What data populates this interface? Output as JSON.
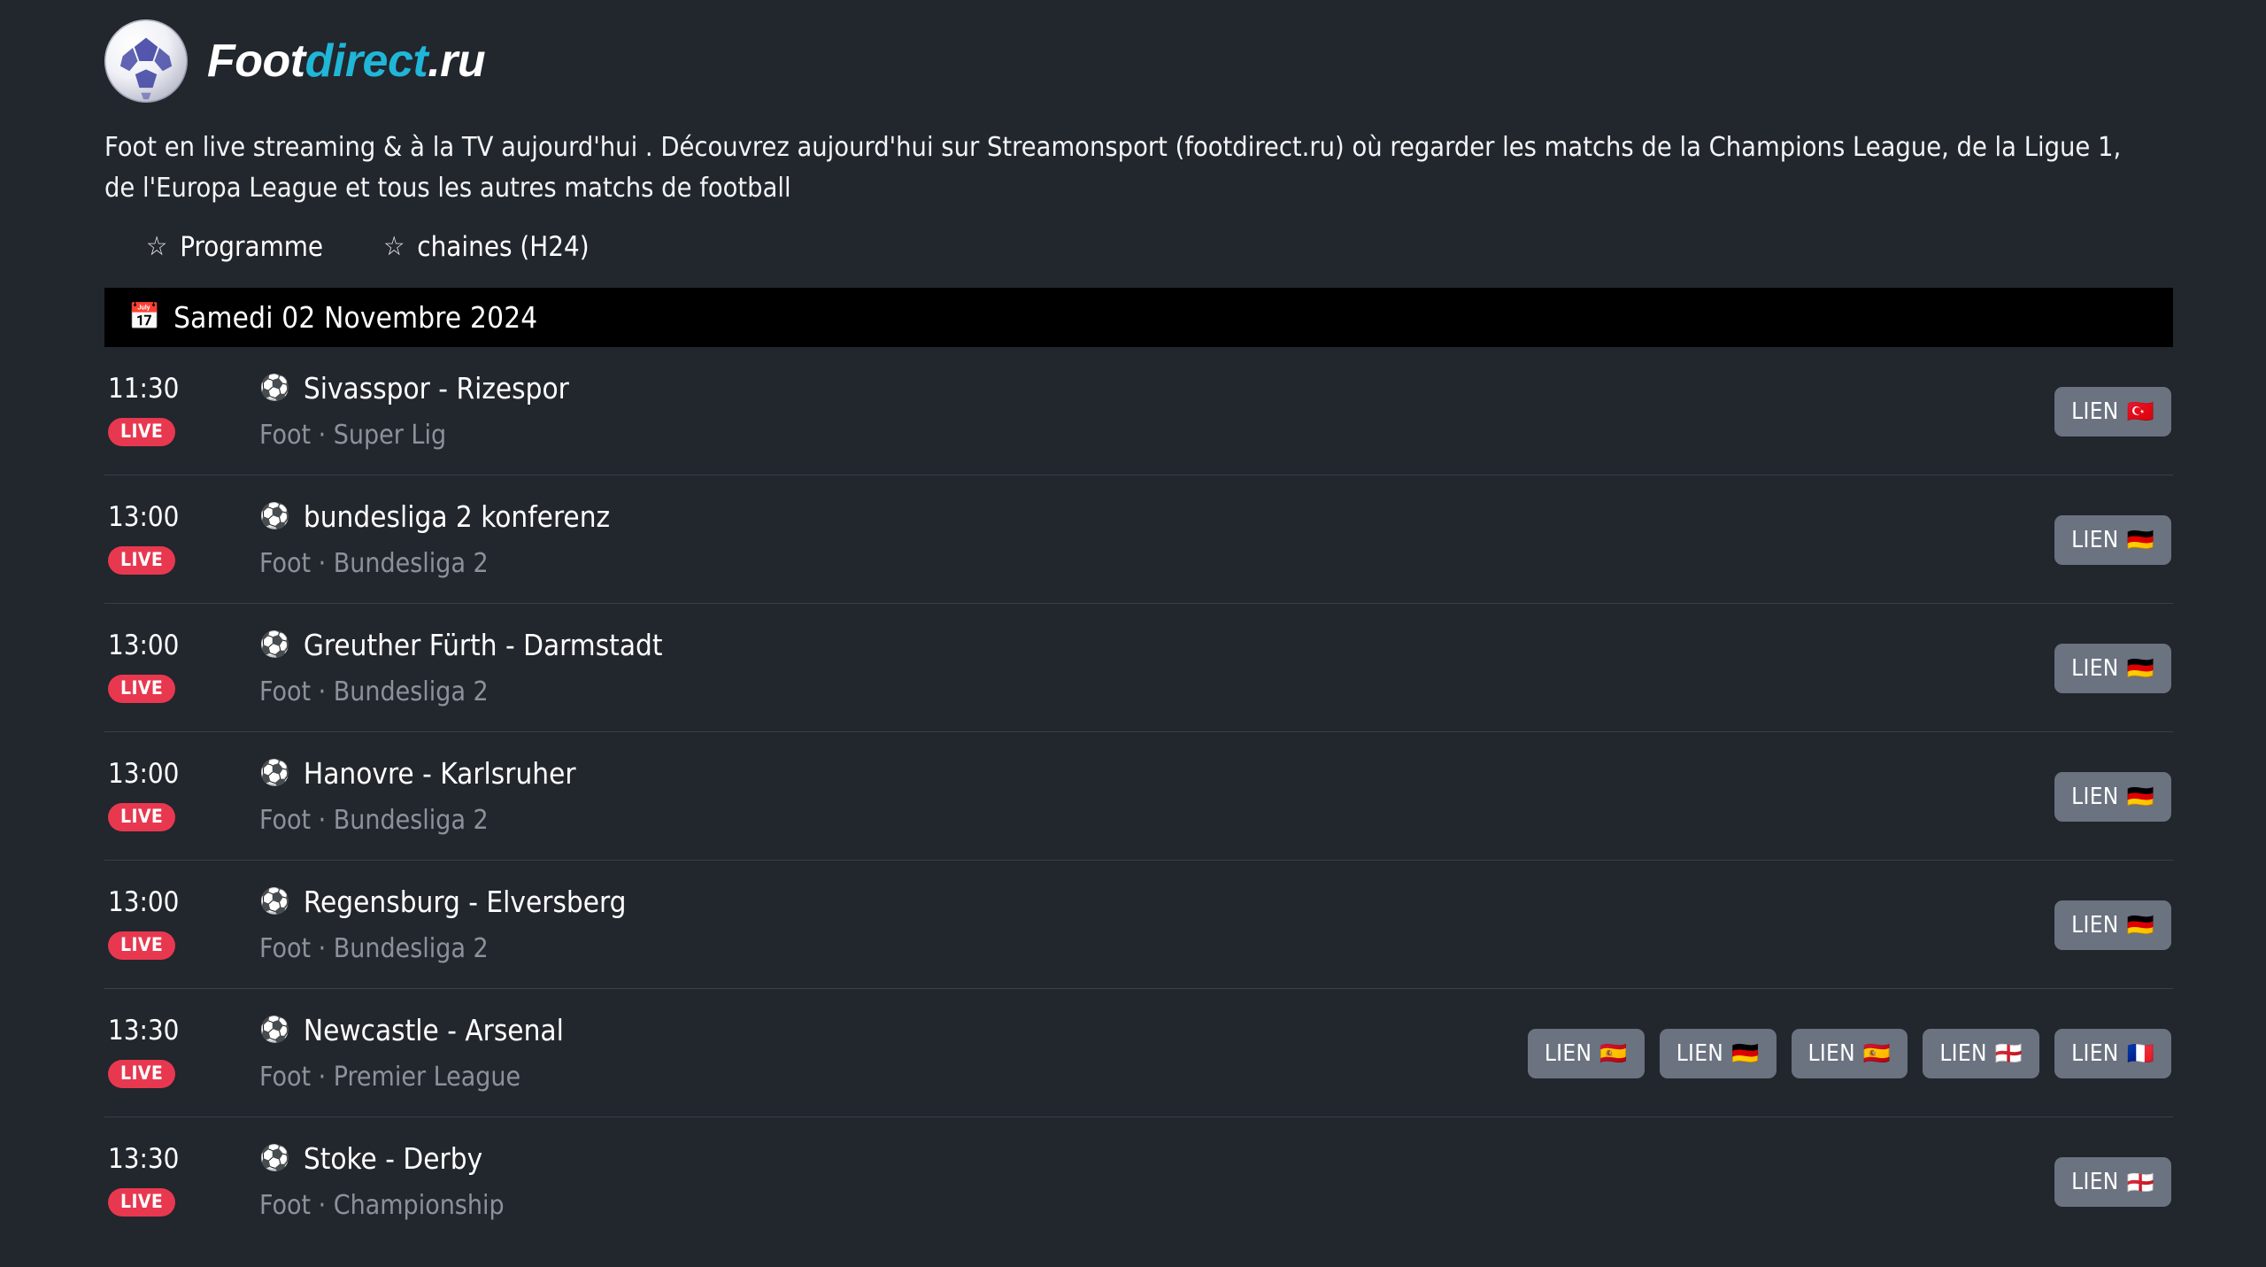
{
  "brand": {
    "part1": "Foot",
    "part2": "direct",
    "part3": ".ru",
    "logo_icon": "soccer-ball-logo",
    "accent_color": "#1fb6d8"
  },
  "description": "Foot en live streaming & à la TV aujourd'hui . Découvrez aujourd'hui sur Streamonsport (footdirect.ru) où regarder les matchs de la Champions League, de la Ligue 1, de l'Europa League et tous les autres matchs de football",
  "nav": {
    "items": [
      {
        "label": "Programme",
        "icon": "star-outline-icon",
        "glyph": "☆"
      },
      {
        "label": "chaines (H24)",
        "icon": "star-outline-icon",
        "glyph": "☆"
      }
    ]
  },
  "date_banner": {
    "icon": "calendar-icon",
    "glyph": "📅",
    "text": "Samedi 02 Novembre 2024",
    "background_color": "#000000"
  },
  "live_badge_label": "LIVE",
  "live_badge_color": "#e8384f",
  "link_button_label": "LIEN",
  "link_button_color": "#6b7280",
  "match_icon": "soccer-ball-icon",
  "match_icon_glyph": "⚽",
  "matches": [
    {
      "time": "11:30",
      "status": "LIVE",
      "title": "Sivasspor - Rizespor",
      "meta": "Foot · Super Lig",
      "sport": "Foot",
      "competition": "Super Lig",
      "links": [
        {
          "label": "LIEN",
          "flag": "🇹🇷",
          "flag_name": "turkey-flag-icon"
        }
      ]
    },
    {
      "time": "13:00",
      "status": "LIVE",
      "title": "bundesliga 2 konferenz",
      "meta": "Foot · Bundesliga 2",
      "sport": "Foot",
      "competition": "Bundesliga 2",
      "links": [
        {
          "label": "LIEN",
          "flag": "🇩🇪",
          "flag_name": "germany-flag-icon"
        }
      ]
    },
    {
      "time": "13:00",
      "status": "LIVE",
      "title": "Greuther Fürth - Darmstadt",
      "meta": "Foot · Bundesliga 2",
      "sport": "Foot",
      "competition": "Bundesliga 2",
      "links": [
        {
          "label": "LIEN",
          "flag": "🇩🇪",
          "flag_name": "germany-flag-icon"
        }
      ]
    },
    {
      "time": "13:00",
      "status": "LIVE",
      "title": "Hanovre - Karlsruher",
      "meta": "Foot · Bundesliga 2",
      "sport": "Foot",
      "competition": "Bundesliga 2",
      "links": [
        {
          "label": "LIEN",
          "flag": "🇩🇪",
          "flag_name": "germany-flag-icon"
        }
      ]
    },
    {
      "time": "13:00",
      "status": "LIVE",
      "title": "Regensburg - Elversberg",
      "meta": "Foot · Bundesliga 2",
      "sport": "Foot",
      "competition": "Bundesliga 2",
      "links": [
        {
          "label": "LIEN",
          "flag": "🇩🇪",
          "flag_name": "germany-flag-icon"
        }
      ]
    },
    {
      "time": "13:30",
      "status": "LIVE",
      "title": "Newcastle - Arsenal",
      "meta": "Foot · Premier League",
      "sport": "Foot",
      "competition": "Premier League",
      "links": [
        {
          "label": "LIEN",
          "flag": "🇪🇸",
          "flag_name": "spain-flag-icon"
        },
        {
          "label": "LIEN",
          "flag": "🇩🇪",
          "flag_name": "germany-flag-icon"
        },
        {
          "label": "LIEN",
          "flag": "🇪🇸",
          "flag_name": "spain-flag-icon"
        },
        {
          "label": "LIEN",
          "flag": "🏴󠁧󠁢󠁥󠁮󠁧󠁿",
          "flag_name": "england-flag-icon"
        },
        {
          "label": "LIEN",
          "flag": "🇫🇷",
          "flag_name": "france-flag-icon"
        }
      ]
    },
    {
      "time": "13:30",
      "status": "LIVE",
      "title": "Stoke - Derby",
      "meta": "Foot · Championship",
      "sport": "Foot",
      "competition": "Championship",
      "links": [
        {
          "label": "LIEN",
          "flag": "🏴󠁧󠁢󠁥󠁮󠁧󠁿",
          "flag_name": "england-flag-icon"
        }
      ]
    }
  ]
}
